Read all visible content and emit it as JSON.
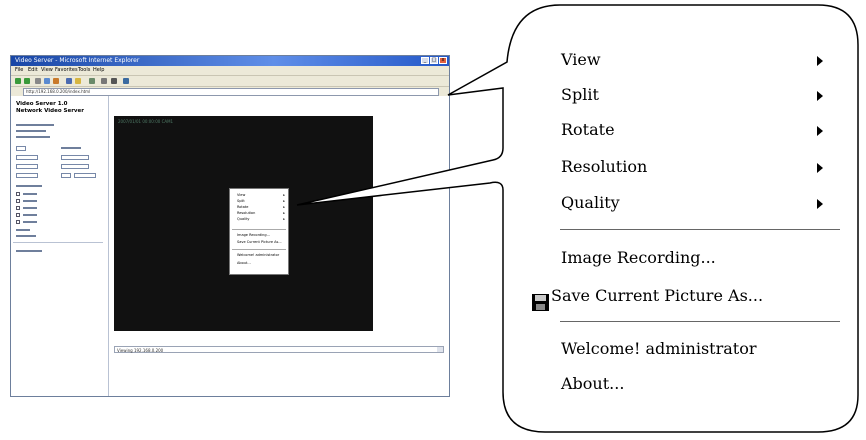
{
  "window": {
    "title": "Video Server - Microsoft Internet Explorer",
    "menu": [
      "File",
      "Edit",
      "View",
      "Favorites",
      "Tools",
      "Help"
    ],
    "address": "http://192.168.0.200/index.html"
  },
  "left_panel": {
    "title_line1": "Video Server 1.0",
    "title_line2": "Network Video Server"
  },
  "video": {
    "caption": "2007/01/01 00:00:00 CAM1"
  },
  "status": {
    "text": "Viewing 192.168.0.200"
  },
  "context_menu": {
    "items": [
      {
        "label": "View",
        "submenu": true
      },
      {
        "label": "Split",
        "submenu": true
      },
      {
        "label": "Rotate",
        "submenu": true
      },
      {
        "label": "Resolution",
        "submenu": true
      },
      {
        "label": "Quality",
        "submenu": true
      },
      {
        "label": "Image Recording...",
        "submenu": false
      },
      {
        "label": "Save Current Picture As...",
        "submenu": false,
        "icon": "floppy-disk-icon"
      },
      {
        "label": "Welcome! administrator",
        "submenu": false
      },
      {
        "label": "About...",
        "submenu": false
      }
    ]
  }
}
